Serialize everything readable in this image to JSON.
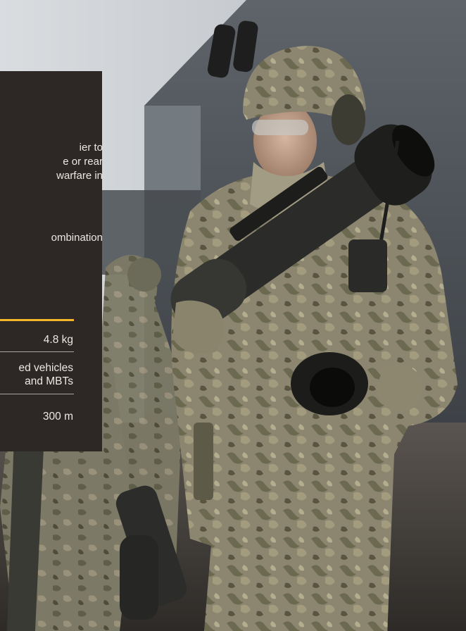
{
  "hero_image": {
    "description_name": "soldier-with-launcher-photo"
  },
  "panel": {
    "desc_lines": [
      "ier to",
      "e or rear",
      " warfare in",
      "",
      "",
      "ombination"
    ],
    "specs": [
      {
        "value": "4.8 kg"
      },
      {
        "value_line1": "ed vehicles",
        "value_line2": "and MBTs"
      },
      {
        "value": "300 m"
      }
    ]
  },
  "colors": {
    "panel_bg": "#2d2826",
    "accent": "#f2b62a"
  }
}
